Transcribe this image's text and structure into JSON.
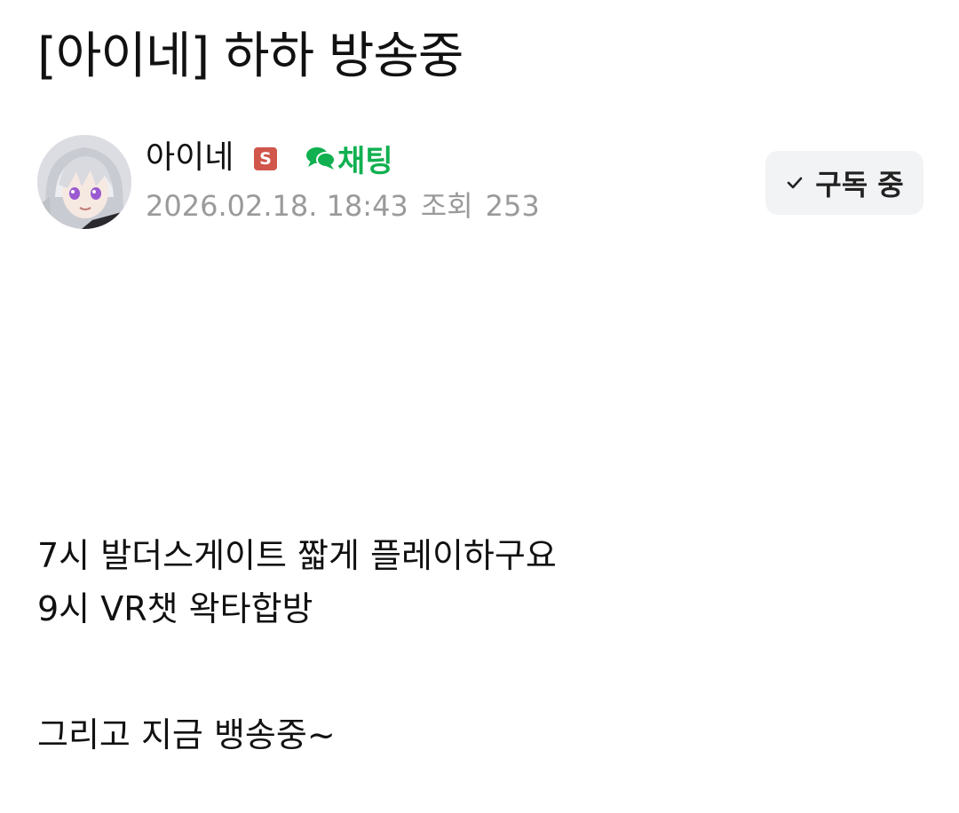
{
  "post": {
    "title": "[아이네] 하하 방송중"
  },
  "author": {
    "name": "아이네",
    "badge": "S",
    "chat_label": "채팅",
    "date": "2026.02.18. 18:43",
    "views_label": "조회",
    "views": "253"
  },
  "subscribe": {
    "label": "구독 중"
  },
  "body": {
    "lines": [
      "7시 발더스게이트 짧게 플레이하구요",
      "9시 VR챗 왁타합방",
      "",
      "그리고 지금 뱅송중~"
    ]
  },
  "colors": {
    "chat_accent": "#10b050",
    "badge": "#d0554a",
    "meta_text": "#9a9a9a",
    "button_bg": "#f2f3f5"
  },
  "icons": {
    "chat": "chat-bubbles-icon",
    "subscribe": "check-icon",
    "badge": "s-badge-icon"
  }
}
